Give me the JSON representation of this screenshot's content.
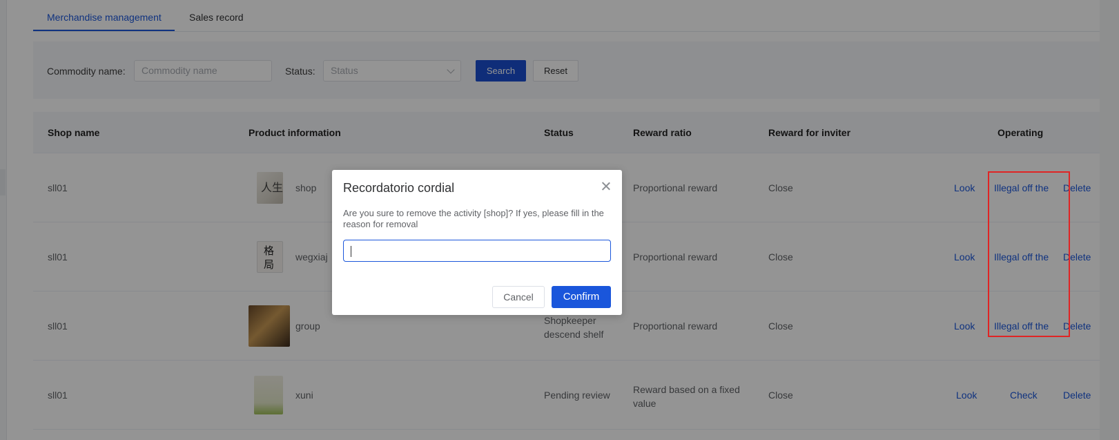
{
  "tabs": [
    {
      "label": "Merchandise management",
      "active": true
    },
    {
      "label": "Sales record",
      "active": false
    }
  ],
  "search": {
    "commodity_label": "Commodity name:",
    "commodity_placeholder": "Commodity name",
    "status_label": "Status:",
    "status_placeholder": "Status",
    "search_button": "Search",
    "reset_button": "Reset"
  },
  "table": {
    "headers": [
      "Shop name",
      "Product information",
      "Status",
      "Reward ratio",
      "Reward for inviter",
      "Operating"
    ],
    "rows": [
      {
        "shop": "sll01",
        "product": "shop",
        "status": "",
        "reward_ratio": "Proportional reward",
        "inviter": "Close",
        "ops": [
          "Look",
          "Illegal off the",
          "Delete"
        ]
      },
      {
        "shop": "sll01",
        "product": "wegxiaj",
        "status": "",
        "reward_ratio": "Proportional reward",
        "inviter": "Close",
        "ops": [
          "Look",
          "Illegal off the",
          "Delete"
        ]
      },
      {
        "shop": "sll01",
        "product": "group",
        "status": "Shopkeeper descend shelf",
        "reward_ratio": "Proportional reward",
        "inviter": "Close",
        "ops": [
          "Look",
          "Illegal off the",
          "Delete"
        ]
      },
      {
        "shop": "sll01",
        "product": "xuni",
        "status": "Pending review",
        "reward_ratio": "Reward based on a fixed value",
        "inviter": "Close",
        "ops": [
          "Look",
          "Check",
          "Delete"
        ]
      }
    ]
  },
  "dialog": {
    "title": "Recordatorio cordial",
    "message": "Are you sure to remove the activity [shop]? If yes, please fill in the reason for removal",
    "input_value": "",
    "cancel": "Cancel",
    "confirm": "Confirm"
  },
  "thumb_icons": [
    "book-cover-life-icon",
    "book-cover-pattern-icon",
    "book-cover-portrait-icon",
    "book-cover-green-icon"
  ],
  "colors": {
    "primary": "#1a56db",
    "highlight": "#e02424",
    "overlay": "rgba(0,0,0,0.42)"
  }
}
